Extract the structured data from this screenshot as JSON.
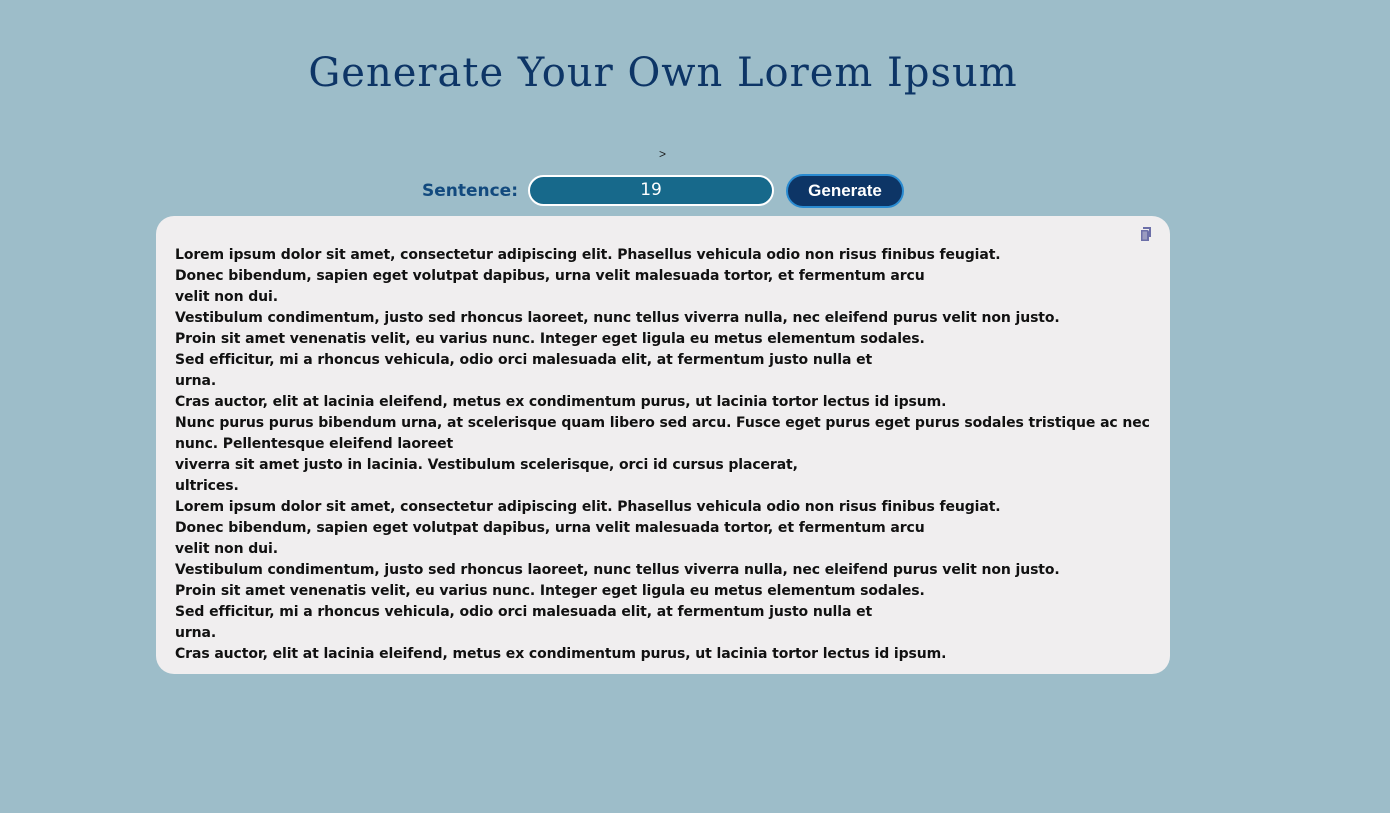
{
  "page": {
    "title": "Generate Your Own Lorem Ipsum",
    "caret_text": ">"
  },
  "controls": {
    "sentence_label": "Sentence:",
    "sentence_value": "19",
    "generate_label": "Generate"
  },
  "output": {
    "copy_icon": "copy-icon",
    "lines": [
      "Lorem ipsum dolor sit amet, consectetur adipiscing elit. Phasellus vehicula odio non risus finibus feugiat.",
      "Donec bibendum, sapien eget volutpat dapibus, urna velit malesuada tortor, et fermentum arcu",
      "velit non dui.",
      "Vestibulum condimentum, justo sed rhoncus laoreet, nunc tellus viverra nulla, nec eleifend purus velit non justo.",
      "Proin sit amet venenatis velit, eu varius nunc. Integer eget ligula eu metus elementum sodales.",
      "Sed efficitur, mi a rhoncus vehicula, odio orci malesuada elit, at fermentum justo nulla et",
      "urna.",
      "Cras auctor, elit at lacinia eleifend, metus ex condimentum purus, ut lacinia tortor lectus id ipsum.",
      "Nunc purus purus bibendum urna, at scelerisque quam libero sed arcu. Fusce eget purus eget purus sodales tristique ac nec",
      "nunc. Pellentesque eleifend laoreet",
      "viverra sit amet justo in lacinia. Vestibulum scelerisque, orci id cursus placerat,",
      "ultrices.",
      "Lorem ipsum dolor sit amet, consectetur adipiscing elit. Phasellus vehicula odio non risus finibus feugiat.",
      "Donec bibendum, sapien eget volutpat dapibus, urna velit malesuada tortor, et fermentum arcu",
      "velit non dui.",
      "Vestibulum condimentum, justo sed rhoncus laoreet, nunc tellus viverra nulla, nec eleifend purus velit non justo.",
      "Proin sit amet venenatis velit, eu varius nunc. Integer eget ligula eu metus elementum sodales.",
      "Sed efficitur, mi a rhoncus vehicula, odio orci malesuada elit, at fermentum justo nulla et",
      "urna.",
      "Cras auctor, elit at lacinia eleifend, metus ex condimentum purus, ut lacinia tortor lectus id ipsum."
    ]
  },
  "colors": {
    "background": "#9dbdc9",
    "title": "#0d3566",
    "label": "#124a7e",
    "input_background": "#17698b",
    "button_background": "#0d3566",
    "button_border": "#2a8bd1",
    "card_background": "#f0eeef",
    "icon": "#6c6fa8"
  }
}
